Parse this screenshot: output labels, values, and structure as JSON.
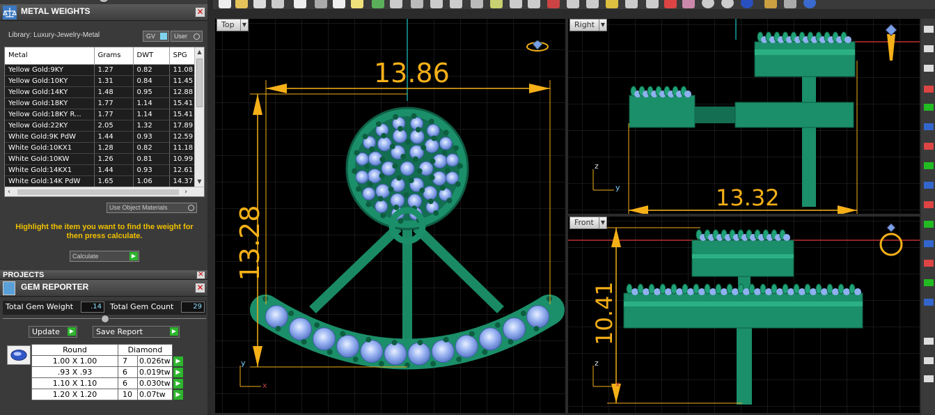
{
  "metal_weights": {
    "title": "METAL WEIGHTS",
    "close": "✕",
    "library_label": "Library: Luxury-Jewelry-Metal",
    "gv_label": "GV",
    "user_label": "User",
    "columns": [
      "Metal",
      "Grams",
      "DWT",
      "SPG"
    ],
    "rows": [
      [
        "Yellow Gold:9KY",
        "1.27",
        "0.82",
        "11.08"
      ],
      [
        "Yellow Gold:10KY",
        "1.31",
        "0.84",
        "11.45"
      ],
      [
        "Yellow Gold:14KY",
        "1.48",
        "0.95",
        "12.88"
      ],
      [
        "Yellow Gold:18KY",
        "1.77",
        "1.14",
        "15.41"
      ],
      [
        "Yellow Gold:18KY R...",
        "1.77",
        "1.14",
        "15.41"
      ],
      [
        "Yellow Gold:22KY",
        "2.05",
        "1.32",
        "17.89"
      ],
      [
        "White Gold:9K PdW",
        "1.44",
        "0.93",
        "12.59"
      ],
      [
        "White Gold:10KX1",
        "1.28",
        "0.82",
        "11.18"
      ],
      [
        "White Gold:10KW",
        "1.26",
        "0.81",
        "10.99"
      ],
      [
        "White Gold:14KX1",
        "1.44",
        "0.93",
        "12.61"
      ],
      [
        "White Gold:14K PdW",
        "1.65",
        "1.06",
        "14.37"
      ]
    ],
    "use_object_materials": "Use Object Materials",
    "hint": "Highlight the item you want to find the weight for then press calculate.",
    "calculate": "Calculate"
  },
  "projects": {
    "title": "PROJECTS",
    "close": "✕"
  },
  "gem_reporter": {
    "title": "GEM REPORTER",
    "close": "✕",
    "total_weight_label": "Total Gem Weight",
    "total_weight_value": ".14",
    "total_count_label": "Total Gem Count",
    "total_count_value": "29",
    "update": "Update",
    "save_report": "Save Report",
    "columns": [
      "Round",
      "Diamond"
    ],
    "rows": [
      [
        "1.00 X 1.00",
        "7",
        "0.026tw"
      ],
      [
        ".93 X .93",
        "6",
        "0.019tw"
      ],
      [
        "1.10 X 1.10",
        "6",
        "0.030tw"
      ],
      [
        "1.20 X 1.20",
        "10",
        "0.07tw"
      ]
    ]
  },
  "viewports": {
    "top": {
      "label": "Top",
      "dim_h": "13.86",
      "dim_v": "13.28"
    },
    "right": {
      "label": "Right",
      "dim_h": "13.32"
    },
    "front": {
      "label": "Front",
      "dim_v": "10.41"
    }
  },
  "axes": {
    "x": "x",
    "y": "y",
    "z": "z"
  },
  "colors": {
    "metal": "#1b8f6a",
    "gem": "#8fb0f0",
    "dimension": "#f5b018",
    "grid": "#2e2e2e",
    "accent_green": "#2db52d"
  }
}
